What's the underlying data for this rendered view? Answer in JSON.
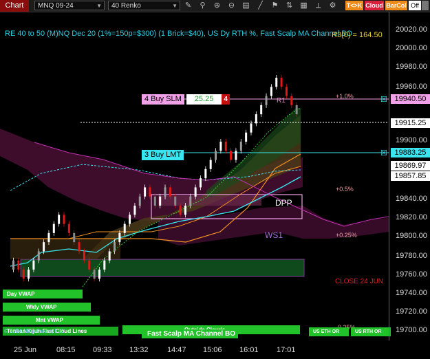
{
  "toolbar": {
    "chart_label": "Chart",
    "instrument": "MNQ 09-24",
    "bar_type": "40 Renko",
    "icons": [
      "draw-tools-icon",
      "magnet-icon",
      "zoom-in-icon",
      "zoom-out-icon",
      "properties-icon",
      "lines-icon",
      "strategies-icon",
      "chart-trader-icon",
      "data-box-icon",
      "ruler-icon",
      "settings-icon"
    ],
    "tk_label": "T<>K",
    "cloud_label": "Cloud",
    "barcol_label": "BarCol",
    "off_label": "Off",
    "colors": {
      "chart_btn": "#8a0d0d",
      "tk": "#f08a18",
      "cloud": "#d8203a",
      "barcol": "#f08a18"
    }
  },
  "header": {
    "title": "RE 40 to 50 (M)NQ Dec 20 (1%=150p=$300) (1 Brick=$40), US Dy RTH %, Fast Scalp MA Channel BO",
    "value_text": "R3(0) = 164.50"
  },
  "price_axis": {
    "labels": [
      "20020.00",
      "20000.00",
      "19980.00",
      "19960.00",
      "19900.00",
      "19840.00",
      "19820.00",
      "19800.00",
      "19780.00",
      "19760.00",
      "19740.00",
      "19720.00",
      "19700.00"
    ],
    "badges": [
      {
        "text": "19940.50",
        "bg": "#f0a0e6",
        "fg": "#000"
      },
      {
        "text": "19915.25",
        "bg": "#ffffff",
        "fg": "#000"
      },
      {
        "text": "19883.25",
        "bg": "#39e6f0",
        "fg": "#000"
      },
      {
        "text": "19869.97",
        "bg": "#ffffff",
        "fg": "#000"
      },
      {
        "text": "19857.85",
        "bg": "#ffffff",
        "fg": "#000"
      }
    ]
  },
  "time_axis": {
    "labels": [
      "25 Jun",
      "08:15",
      "09:33",
      "13:32",
      "14:47",
      "15:06",
      "16:01",
      "17:01"
    ]
  },
  "orders": {
    "stop": {
      "label": "4 Buy SLM",
      "price": "25.25",
      "qty": "4"
    },
    "limit": {
      "label": "3 Buy LMT"
    }
  },
  "levels": {
    "pct_1": "+1.0%",
    "pct_05": "+0.5%",
    "pct_025": "+0.25%",
    "pct_neg025": "-0.25%",
    "r1": "R1",
    "dpp": "DPP",
    "ws1": "WS1",
    "close": "CLOSE 24 JUN"
  },
  "bottom": {
    "vwap_day": "Day VWAP",
    "vwap_wkly": "Wkly VWAP",
    "vwap_mnt": "Mnt VWAP",
    "copyright": "© 2024 NinjaTrader, LLC",
    "ichimoku": "Tenkan Kijun Fast Cloud Lines",
    "outside": "Outside Clouds",
    "fast_scalp": "Fast Scalp MA Channel BO",
    "us_eth": "US ETH OR",
    "us_rth": "US RTH OR"
  },
  "chart_data": {
    "type": "renko",
    "brick_size": 10,
    "ylim": [
      19680,
      20030
    ],
    "bricks": [
      19760,
      19750,
      19740,
      19750,
      19760,
      19770,
      19780,
      19790,
      19800,
      19810,
      19800,
      19790,
      19780,
      19770,
      19760,
      19750,
      19740,
      19750,
      19760,
      19770,
      19780,
      19790,
      19800,
      19810,
      19820,
      19830,
      19840,
      19830,
      19820,
      19830,
      19840,
      19830,
      19820,
      19810,
      19820,
      19830,
      19840,
      19850,
      19860,
      19870,
      19880,
      19890,
      19880,
      19870,
      19880,
      19890,
      19900,
      19910,
      19920,
      19930,
      19940,
      19950,
      19960,
      19950,
      19940,
      19930,
      19920
    ],
    "first_label": "25 Jun",
    "last_label": "17:01"
  }
}
